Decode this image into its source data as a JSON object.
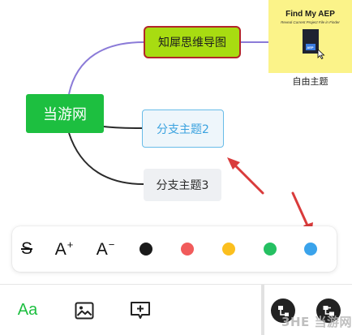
{
  "mindmap": {
    "central_topic": "当游网",
    "topics": [
      "知犀思维导图",
      "分支主题2",
      "分支主题3"
    ],
    "floating_topic_caption": "自由主题",
    "image_card": {
      "title": "Find My AEP",
      "subtitle": "Reveal Current Project File in Finder",
      "badge": "AEP"
    }
  },
  "format_toolbar": {
    "items": [
      {
        "name": "strikethrough",
        "label": "S"
      },
      {
        "name": "increase-font-size",
        "label": "A",
        "suffix": "+"
      },
      {
        "name": "decrease-font-size",
        "label": "A",
        "suffix": "−"
      }
    ],
    "colors": [
      "#1a1a1a",
      "#f15b5b",
      "#fbbf1e",
      "#25c062",
      "#3aa3eb"
    ]
  },
  "bottom_toolbar": {
    "text_style_label": "Aa"
  },
  "watermark": "3HE 当游网",
  "colors": {
    "central": "#1dbf40",
    "topic1_fill": "#a8dc11",
    "topic1_border": "#b3262a",
    "link_purple": "#8b7bd8",
    "link_dark": "#2a2a2a",
    "annotation_arrow": "#d93b3b"
  }
}
